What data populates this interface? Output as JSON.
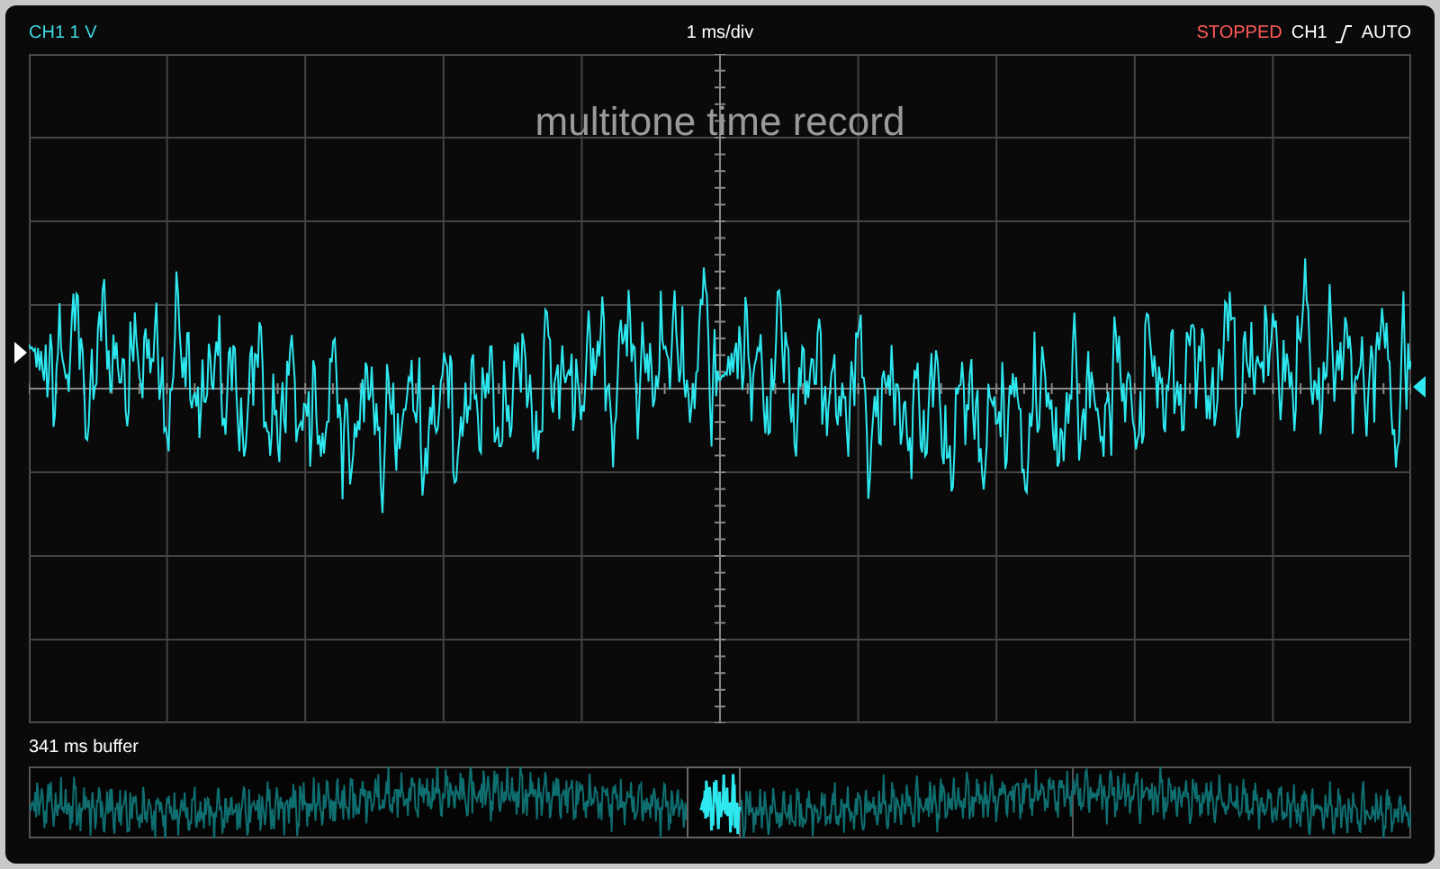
{
  "header": {
    "channel_scale": "CH1 1 V",
    "timebase": "1 ms/div",
    "status": {
      "text": "STOPPED",
      "kind": "stopped"
    },
    "trigger_source": "CH1",
    "trigger_mode": "AUTO"
  },
  "plot": {
    "title": "multitone time record"
  },
  "buffer": {
    "label": "341 ms buffer"
  }
}
